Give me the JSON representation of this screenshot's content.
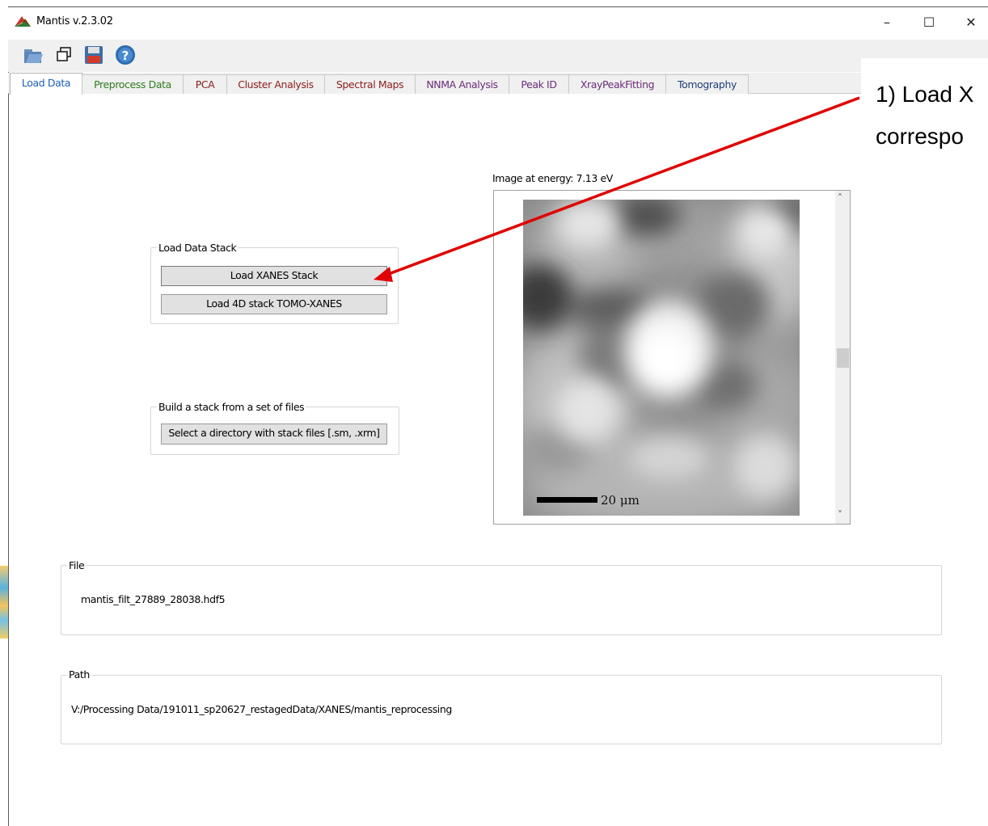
{
  "window": {
    "title": "Mantis v.2.3.02",
    "controls": {
      "minimize": "–",
      "maximize": "☐",
      "close": "✕"
    }
  },
  "toolbar": {
    "icons": [
      "open-folder-icon",
      "windows-icon",
      "save-icon",
      "help-icon"
    ]
  },
  "tabs": [
    {
      "label": "Load Data",
      "color": "#1b5fb5",
      "active": true
    },
    {
      "label": "Preprocess Data",
      "color": "#2e7d1f"
    },
    {
      "label": "PCA",
      "color": "#8b1d1d"
    },
    {
      "label": "Cluster Analysis",
      "color": "#8b1d1d"
    },
    {
      "label": "Spectral Maps",
      "color": "#8b1d1d"
    },
    {
      "label": "NNMA Analysis",
      "color": "#6a2c7a"
    },
    {
      "label": "Peak ID",
      "color": "#6a2c7a"
    },
    {
      "label": "XrayPeakFitting",
      "color": "#6a2c7a"
    },
    {
      "label": "Tomography",
      "color": "#1f3f7a"
    }
  ],
  "load_stack_group": {
    "title": "Load Data Stack",
    "buttons": [
      "Load XANES Stack",
      "Load 4D stack TOMO-XANES"
    ]
  },
  "build_stack_group": {
    "title": "Build a stack from a set of files",
    "button": "Select a directory with stack files  [.sm, .xrm]"
  },
  "image_panel": {
    "label": "Image at energy:  7.13 eV",
    "scale_bar": "20 μm",
    "scroll_up": "˄",
    "scroll_down": "˅"
  },
  "file_group": {
    "title": "File",
    "value": "mantis_filt_27889_28038.hdf5"
  },
  "path_group": {
    "title": "Path",
    "value": "V:/Processing Data/191011_sp20627_restagedData/XANES/mantis_reprocessing"
  },
  "annotation": {
    "line1": "1) Load X",
    "line2": "correspo",
    "arrow_color": "#e00000"
  }
}
